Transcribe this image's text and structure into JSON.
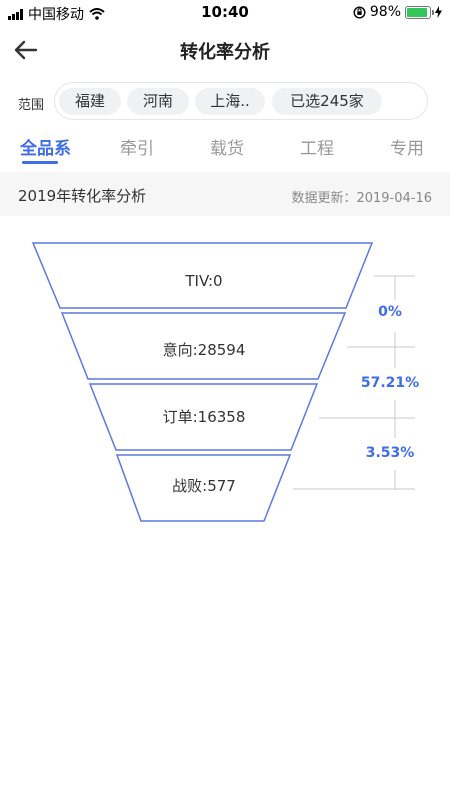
{
  "status_bar": {
    "carrier": "中国移动",
    "time": "10:40",
    "battery": "98%"
  },
  "nav": {
    "title": "转化率分析"
  },
  "scope": {
    "label": "范围",
    "chips": [
      "福建",
      "河南",
      "上海..",
      "已选245家"
    ]
  },
  "tabs": [
    "全品系",
    "牵引",
    "载货",
    "工程",
    "专用"
  ],
  "active_tab": "全品系",
  "section": {
    "title": "2019年转化率分析",
    "updated": "数据更新：2019-04-16"
  },
  "funnel": {
    "stages": [
      {
        "label": "TIV:0",
        "name": "TIV",
        "value": 0
      },
      {
        "label": "意向:28594",
        "name": "意向",
        "value": 28594
      },
      {
        "label": "订单:16358",
        "name": "订单",
        "value": 16358
      },
      {
        "label": "战败:577",
        "name": "战败",
        "value": 577
      }
    ],
    "rates": [
      "0%",
      "57.21%",
      "3.53%"
    ]
  },
  "colors": {
    "accent": "#3d6ee8",
    "funnel_stroke": "#5b79e0"
  }
}
